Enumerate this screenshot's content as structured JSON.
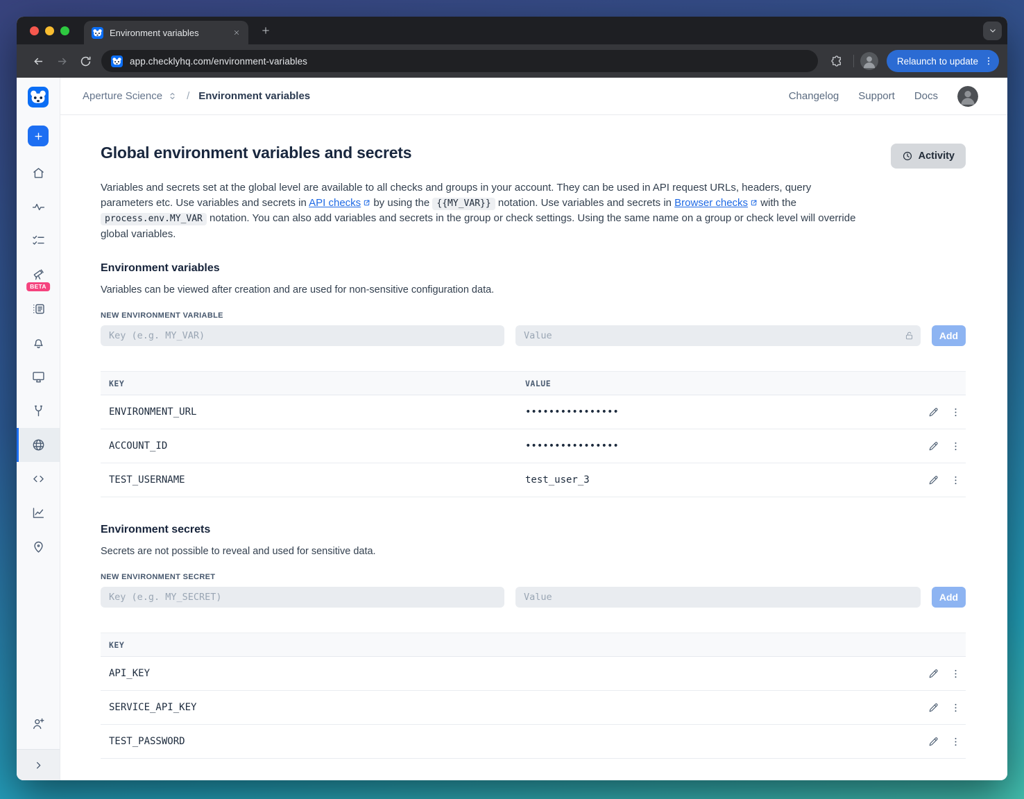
{
  "browser": {
    "tab_title": "Environment variables",
    "url": "app.checklyhq.com/environment-variables",
    "relaunch_label": "Relaunch to update"
  },
  "header": {
    "account_name": "Aperture Science",
    "breadcrumb_separator": "/",
    "current_page": "Environment variables",
    "nav": {
      "changelog": "Changelog",
      "support": "Support",
      "docs": "Docs"
    }
  },
  "sidebar": {
    "beta_badge": "BETA"
  },
  "page": {
    "title": "Global environment variables and secrets",
    "activity_button": "Activity",
    "intro": [
      {
        "t": "text",
        "v": "Variables and secrets set at the global level are available to all checks and groups in your account. They can be used in API request URLs, headers, query parameters etc. Use variables and secrets in "
      },
      {
        "t": "link",
        "v": "API checks",
        "name": "api-checks-link"
      },
      {
        "t": "text",
        "v": " by using the "
      },
      {
        "t": "code",
        "v": "{{MY_VAR}}"
      },
      {
        "t": "text",
        "v": " notation. Use variables and secrets in "
      },
      {
        "t": "link",
        "v": "Browser checks",
        "name": "browser-checks-link"
      },
      {
        "t": "text",
        "v": " with the "
      },
      {
        "t": "code",
        "v": "process.env.MY_VAR"
      },
      {
        "t": "text",
        "v": " notation. You can also add variables and secrets in the group or check settings. Using the same name on a group or check level will override global variables."
      }
    ]
  },
  "variables": {
    "heading": "Environment variables",
    "description": "Variables can be viewed after creation and are used for non-sensitive configuration data.",
    "new_label": "NEW ENVIRONMENT VARIABLE",
    "key_placeholder": "Key (e.g. MY_VAR)",
    "value_placeholder": "Value",
    "add_label": "Add",
    "table": {
      "col_key": "KEY",
      "col_value": "VALUE",
      "rows": [
        {
          "key": "ENVIRONMENT_URL",
          "value": "••••••••••••••••"
        },
        {
          "key": "ACCOUNT_ID",
          "value": "••••••••••••••••"
        },
        {
          "key": "TEST_USERNAME",
          "value": "test_user_3"
        }
      ]
    }
  },
  "secrets": {
    "heading": "Environment secrets",
    "description": "Secrets are not possible to reveal and used for sensitive data.",
    "new_label": "NEW ENVIRONMENT SECRET",
    "key_placeholder": "Key (e.g. MY_SECRET)",
    "value_placeholder": "Value",
    "add_label": "Add",
    "table": {
      "col_key": "KEY",
      "rows": [
        {
          "key": "API_KEY"
        },
        {
          "key": "SERVICE_API_KEY"
        },
        {
          "key": "TEST_PASSWORD"
        }
      ]
    }
  },
  "colors": {
    "accent_blue": "#1d6ff2",
    "add_button_blue": "#8db4f2",
    "link_blue": "#1f6ae5",
    "beta_pink": "#f5437e",
    "relaunch_blue": "#2b6bd3"
  }
}
